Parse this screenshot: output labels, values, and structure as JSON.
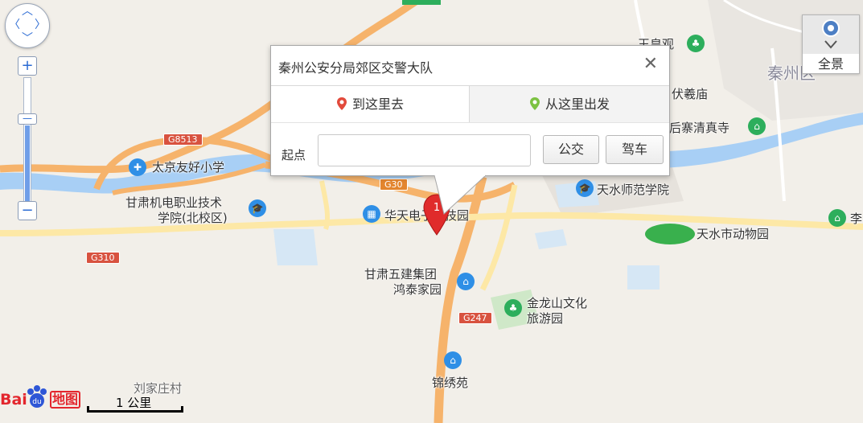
{
  "info_window": {
    "title": "秦州公安分局郊区交警大队",
    "close": "✕",
    "tab_to": "到这里去",
    "tab_from": "从这里出发",
    "start_label": "起点",
    "start_value": "",
    "bus_button": "公交",
    "drive_button": "驾车"
  },
  "panorama": {
    "label": "全景"
  },
  "zoom": {
    "in": "+",
    "out": "−"
  },
  "scale": {
    "label": "1 公里"
  },
  "marker": {
    "label": "1"
  },
  "logo": {
    "text": "Bai",
    "text2": "地图"
  },
  "roads": {
    "g8513": "G8513",
    "g30": "G30",
    "g310": "G310",
    "g247": "G247"
  },
  "places": {
    "taijing": "太京友好小学",
    "gansu_jidian_1": "甘肃机电职业技术",
    "gansu_jidian_2": "学院(北校区)",
    "huatian": "华天电子科技园",
    "gansu_wujian_1": "甘肃五建集团",
    "gansu_wujian_2": "鸿泰家园",
    "jinlongshan_1": "金龙山文化",
    "jinlongshan_2": "旅游园",
    "jinxiuyuan": "锦绣苑",
    "liujiazhuang": "刘家庄村",
    "tianshui_normal": "天水师范学院",
    "tianshui_zoo": "天水市动物园",
    "houzhai_mosque": "后寨清真寺",
    "fuximiao": "伏羲庙",
    "yuhuangguan": "玉皇观",
    "qinzhou_district": "秦州区",
    "li_partial": "李"
  },
  "colors": {
    "river": "#a8cff5",
    "highway": "#f6b36b",
    "road": "#fde8a6",
    "accent": "#2a6ad3",
    "marker": "#e02b2b"
  }
}
